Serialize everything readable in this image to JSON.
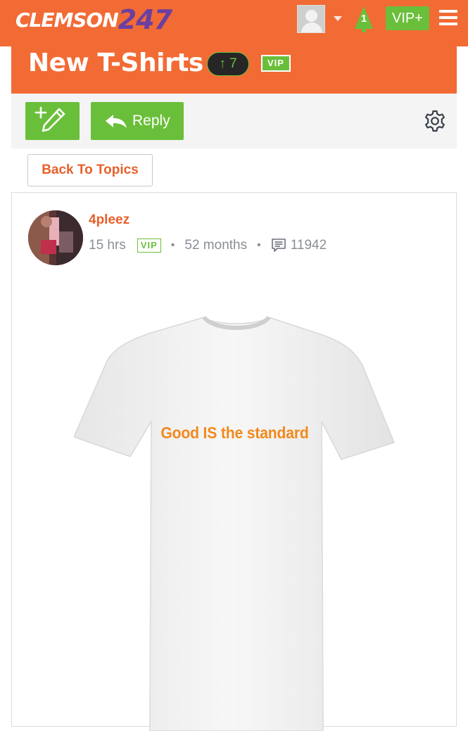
{
  "header": {
    "brand_word": "CLEMSON",
    "brand_number": "247",
    "notification_count": "1",
    "vip_plus_label": "VIP+"
  },
  "topic": {
    "title": "New T-Shirts",
    "vote_arrow": "↑",
    "votes": "7",
    "vip_badge": "VIP"
  },
  "toolbar": {
    "reply_label": "Reply"
  },
  "back_label": "Back To Topics",
  "post": {
    "username": "4pleez",
    "time": "15 hrs",
    "vip_badge": "VIP",
    "membership": "52 months",
    "separator": "•",
    "post_count": "11942",
    "image_text": "Good IS the standard"
  },
  "colors": {
    "brand_orange": "#f26b35",
    "vip_green": "#6abf3a",
    "link_orange": "#e6602a",
    "shirt_text": "#f28a1c"
  }
}
